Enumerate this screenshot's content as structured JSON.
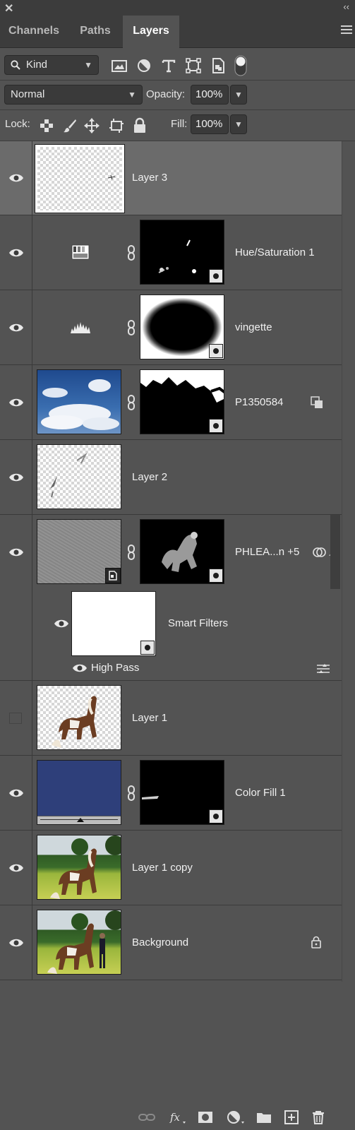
{
  "window": {
    "close_glyph": "✕",
    "collapse_glyph": "‹‹"
  },
  "tabs": [
    {
      "label": "Channels",
      "active": false
    },
    {
      "label": "Paths",
      "active": false
    },
    {
      "label": "Layers",
      "active": true
    }
  ],
  "filter": {
    "kind_label": "Kind",
    "icons": [
      "image-filter-icon",
      "adjustment-filter-icon",
      "type-filter-icon",
      "shape-filter-icon",
      "smart-object-filter-icon",
      "filter-toggle-icon"
    ]
  },
  "blend": {
    "mode": "Normal",
    "opacity_label": "Opacity:",
    "opacity_value": "100%"
  },
  "lock": {
    "label": "Lock:",
    "icons": [
      "lock-transparent-pixels-icon",
      "lock-image-pixels-icon",
      "lock-position-icon",
      "lock-artboard-icon",
      "lock-all-icon"
    ],
    "fill_label": "Fill:",
    "fill_value": "100%"
  },
  "layers": [
    {
      "name": "Layer 3",
      "visible": true,
      "selected": true
    },
    {
      "name": "Hue/Saturation 1",
      "visible": true
    },
    {
      "name": "vingette",
      "visible": true
    },
    {
      "name": "P1350584",
      "visible": true
    },
    {
      "name": "Layer 2",
      "visible": true
    },
    {
      "name": "PHLEA...n +5",
      "visible": true
    },
    {
      "name": "Smart Filters",
      "visible": true
    },
    {
      "name": "High Pass",
      "visible": true
    },
    {
      "name": "Layer 1",
      "visible": false
    },
    {
      "name": "Color Fill 1",
      "visible": true
    },
    {
      "name": "Layer 1 copy",
      "visible": true
    },
    {
      "name": "Background",
      "visible": true
    }
  ],
  "colors": {
    "panel_bg": "#535353",
    "tab_bg": "#3c3c3c",
    "selected_row": "#6b6b6b",
    "color_fill": "#2e3f7a",
    "sky_blue": "#2f5a9c"
  },
  "bottom_icons": [
    "link-layers-icon",
    "fx-icon",
    "add-mask-icon",
    "adjustment-layer-icon",
    "new-group-icon",
    "new-layer-icon",
    "delete-layer-icon"
  ]
}
